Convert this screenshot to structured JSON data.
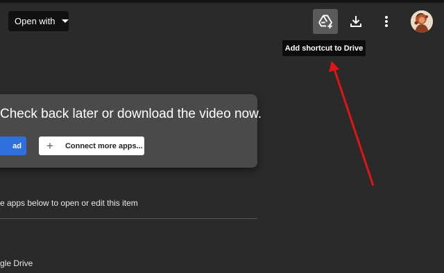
{
  "toolbar": {
    "open_with_label": "Open with",
    "drive_icon": "add-to-drive-icon",
    "download_icon": "download-icon",
    "more_icon": "more-vert-icon"
  },
  "tooltip": {
    "text": "Add shortcut to Drive"
  },
  "card": {
    "message": "Check back later or download the video now.",
    "download_label": "ad",
    "connect_label": "Connect more apps..."
  },
  "content": {
    "instruction": "e apps below to open or edit this item",
    "app_label": "gle Drive"
  },
  "colors": {
    "background": "#2a2a2a",
    "card": "#4a4a4a",
    "accent_blue": "#2f6fde",
    "arrow_red": "#e01515"
  }
}
